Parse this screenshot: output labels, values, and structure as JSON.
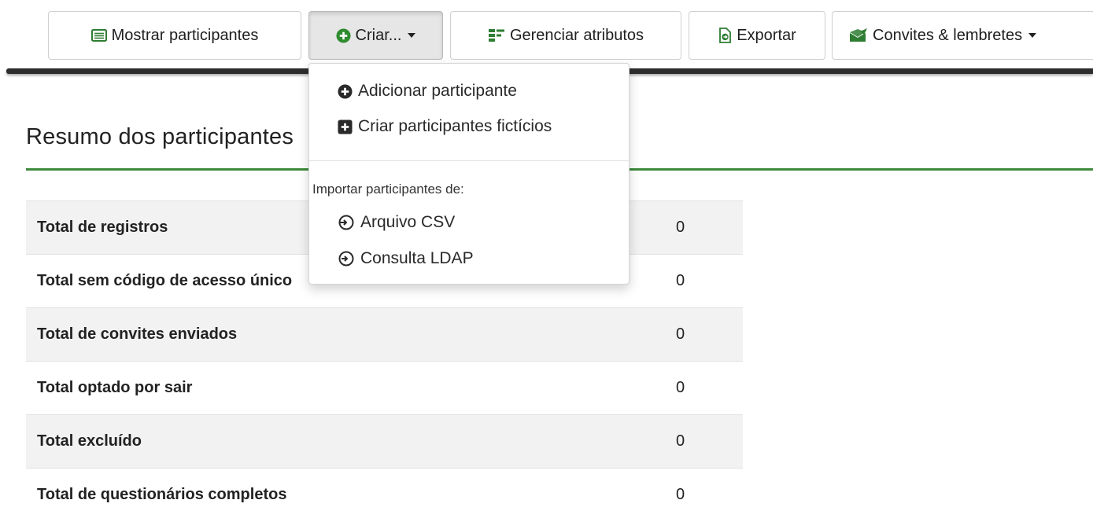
{
  "toolbar": {
    "show_participants": "Mostrar participantes",
    "create": "Criar...",
    "manage_attributes": "Gerenciar atributos",
    "export": "Exportar",
    "invites_reminders": "Convites & lembretes"
  },
  "dropdown": {
    "add_participant": "Adicionar participante",
    "create_dummy": "Criar participantes fictícios",
    "import_header": "Importar participantes de:",
    "csv_file": "Arquivo CSV",
    "ldap_query": "Consulta LDAP"
  },
  "summary": {
    "title": "Resumo dos participantes",
    "rows": [
      {
        "label": "Total de registros",
        "value": "0"
      },
      {
        "label": "Total sem código de acesso único",
        "value": "0"
      },
      {
        "label": "Total de convites enviados",
        "value": "0"
      },
      {
        "label": "Total optado por sair",
        "value": "0"
      },
      {
        "label": "Total excluído",
        "value": "0"
      },
      {
        "label": "Total de questionários completos",
        "value": "0"
      }
    ]
  },
  "colors": {
    "accent_green": "#3d8a3d",
    "toolbar_line": "#2d2d2d"
  }
}
